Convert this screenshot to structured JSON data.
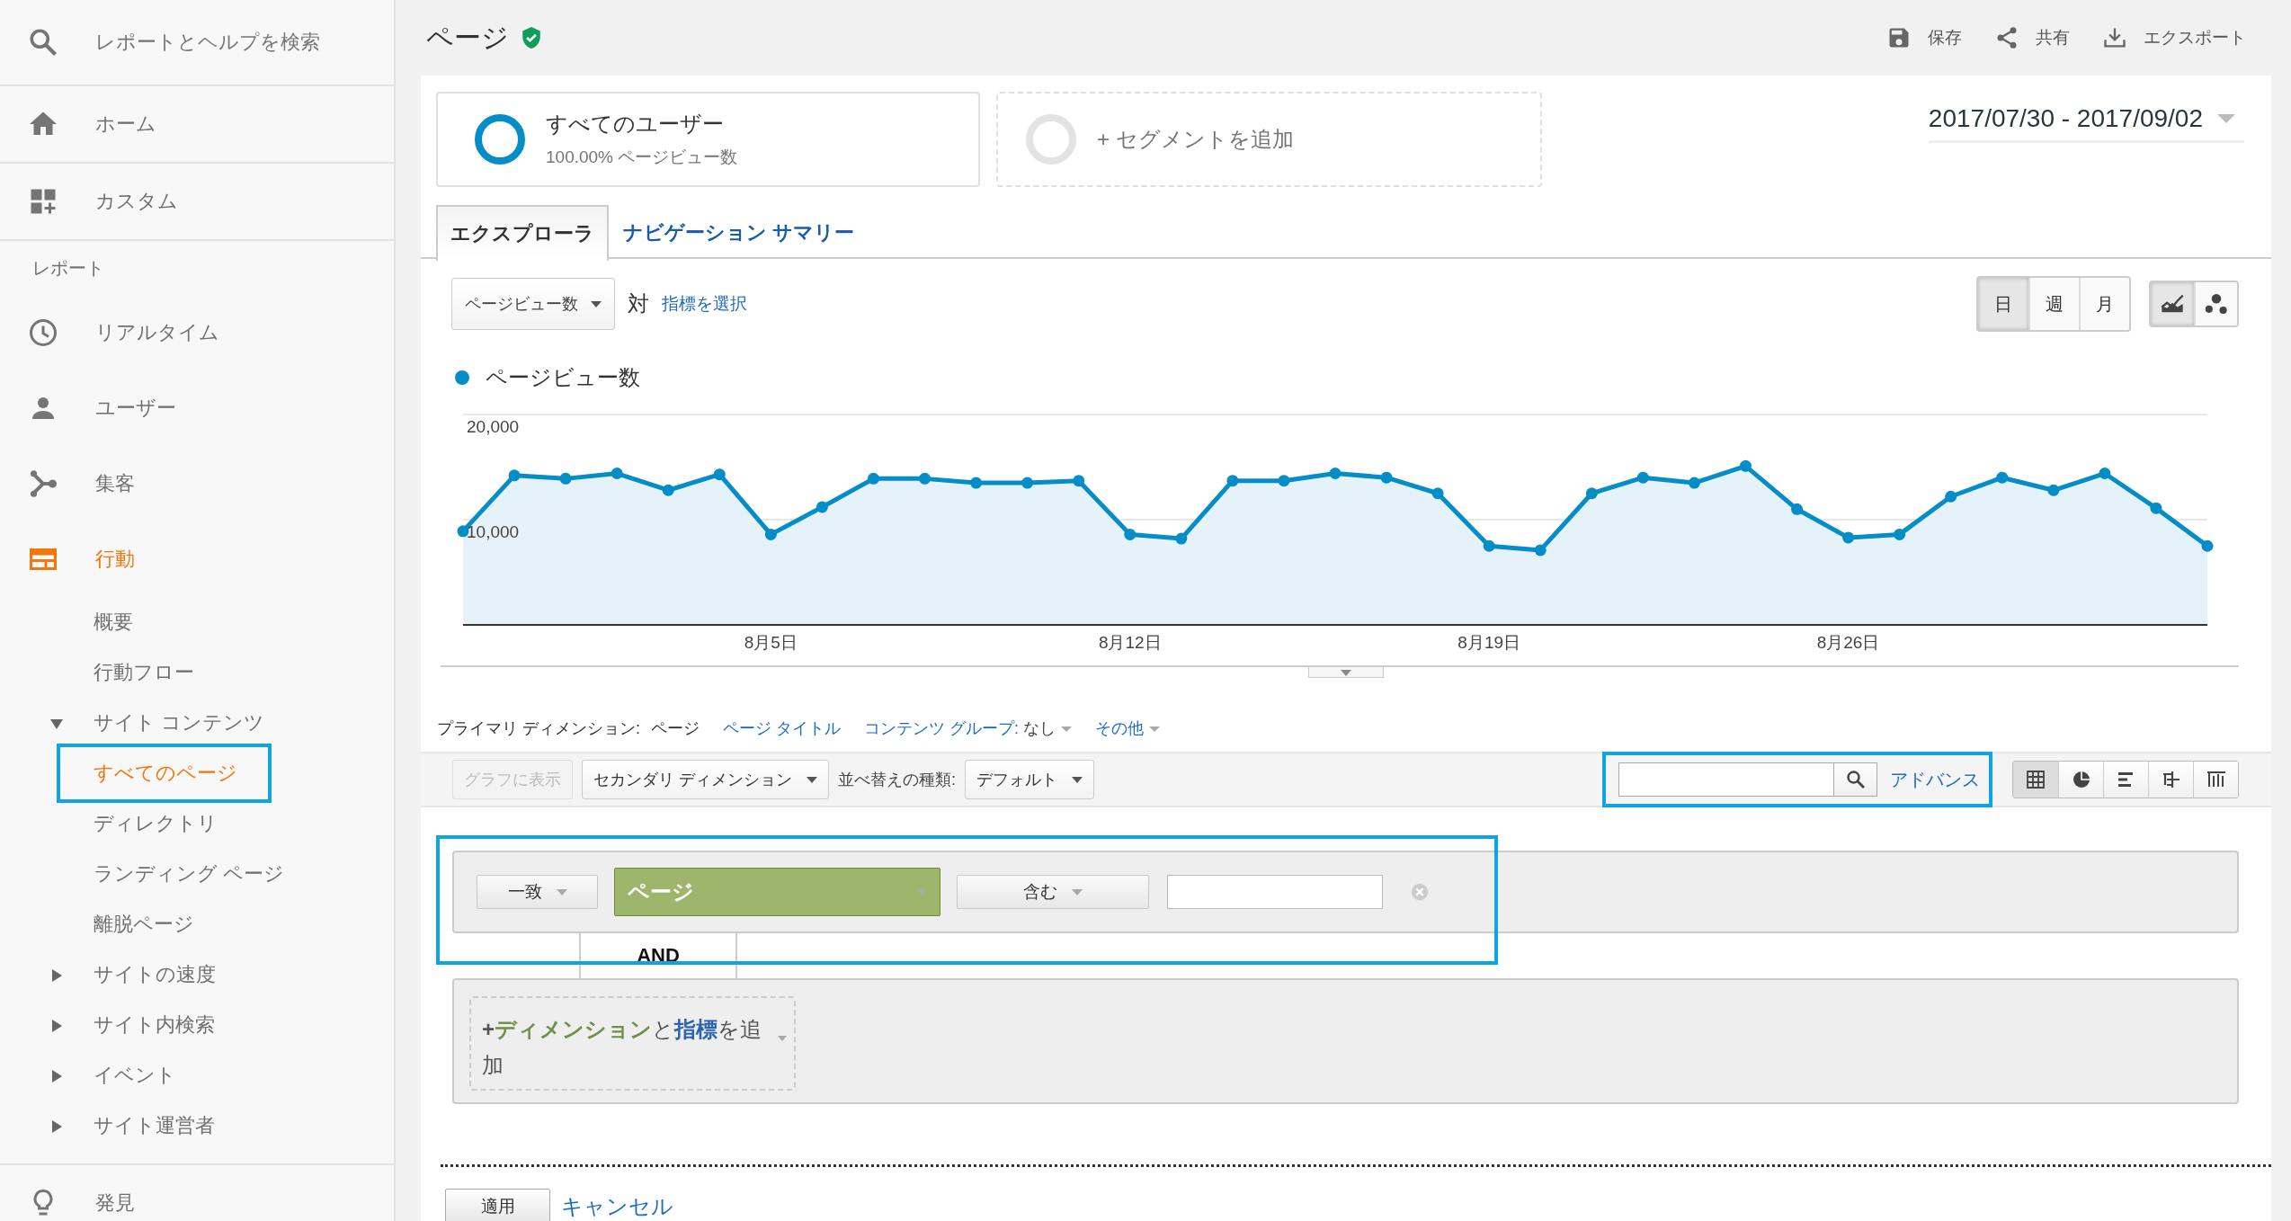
{
  "sidebar": {
    "search": {
      "placeholder": "レポートとヘルプを検索"
    },
    "top_items": [
      {
        "label": "ホーム",
        "selected": false
      },
      {
        "label": "カスタム",
        "selected": false
      }
    ],
    "section_label": "レポート",
    "report_items": [
      {
        "label": "リアルタイム",
        "selected": false
      },
      {
        "label": "ユーザー",
        "selected": false
      },
      {
        "label": "集客",
        "selected": false
      },
      {
        "label": "行動",
        "selected": true,
        "children": [
          {
            "label": "概要",
            "selected": false,
            "highlighted": false
          },
          {
            "label": "行動フロー",
            "selected": false,
            "highlighted": false
          },
          {
            "label": "サイト コンテンツ",
            "selected": false,
            "highlighted": false,
            "expanded": true,
            "children": [
              {
                "label": "すべてのページ",
                "selected": true,
                "highlighted": true
              },
              {
                "label": "ディレクトリ",
                "selected": false,
                "highlighted": false
              },
              {
                "label": "ランディング ページ",
                "selected": false,
                "highlighted": false
              },
              {
                "label": "離脱ページ",
                "selected": false,
                "highlighted": false
              }
            ]
          },
          {
            "label": "サイトの速度",
            "selected": false,
            "highlighted": false,
            "expanded": false
          },
          {
            "label": "サイト内検索",
            "selected": false,
            "highlighted": false,
            "expanded": false
          },
          {
            "label": "イベント",
            "selected": false,
            "highlighted": false,
            "expanded": false
          },
          {
            "label": "サイト運営者",
            "selected": false,
            "highlighted": false,
            "expanded": false
          }
        ]
      }
    ],
    "bottom_items": [
      {
        "label": "発見",
        "selected": false
      }
    ]
  },
  "header": {
    "title": "ページ",
    "actions": [
      "保存",
      "共有",
      "エクスポート"
    ]
  },
  "segments": [
    {
      "kind": "active",
      "title": "すべてのユーザー",
      "subtitle": "100.00% ページビュー数"
    },
    {
      "kind": "add",
      "title": "+ セグメントを追加"
    }
  ],
  "date_range": "2017/07/30 - 2017/09/02",
  "tabs": [
    {
      "label": "エクスプローラ",
      "selected": true
    },
    {
      "label": "ナビゲーション サマリー",
      "selected": false
    }
  ],
  "explorer": {
    "metric_select": "ページビュー数",
    "vs_label": "対",
    "select_metric_link": "指標を選択",
    "granularity": [
      {
        "label": "日",
        "selected": true
      },
      {
        "label": "週",
        "selected": false
      },
      {
        "label": "月",
        "selected": false
      }
    ],
    "chart_types": [
      {
        "selected": true
      },
      {
        "selected": false
      }
    ],
    "chart_data": {
      "type": "area",
      "categories": [
        null,
        null,
        null,
        null,
        null,
        null,
        "8月5日",
        null,
        null,
        null,
        null,
        null,
        null,
        "8月12日",
        null,
        null,
        null,
        null,
        null,
        null,
        "8月19日",
        null,
        null,
        null,
        null,
        null,
        null,
        "8月26日",
        null,
        null,
        null,
        null,
        null,
        null,
        null
      ],
      "yticks": [
        {
          "value": 10000,
          "label": "10,000"
        },
        {
          "value": 20000,
          "label": "20,000"
        }
      ],
      "ylim": [
        0,
        20000
      ],
      "series": [
        {
          "name": "ページビュー数",
          "color": "#058dc7",
          "values": [
            8900,
            14200,
            13900,
            14400,
            12800,
            14300,
            8600,
            11200,
            13900,
            13900,
            13500,
            13500,
            13700,
            8600,
            8200,
            13700,
            13700,
            14400,
            14000,
            12500,
            7500,
            7100,
            12500,
            14000,
            13500,
            15100,
            11000,
            8300,
            8600,
            12200,
            14000,
            12800,
            14400,
            11100,
            7500
          ]
        }
      ]
    }
  },
  "dimensions": {
    "label": "プライマリ ディメンション:",
    "items": [
      {
        "kind": "link",
        "label": "ページ",
        "selected": true
      },
      {
        "kind": "link",
        "label": "ページ タイトル",
        "selected": false
      },
      {
        "kind": "menu",
        "label": "コンテンツ グループ:",
        "value": "なし",
        "selected": false
      },
      {
        "kind": "menu",
        "label": "その他",
        "selected": false
      }
    ]
  },
  "toolbar": {
    "plot_rows": {
      "label": "グラフに表示",
      "disabled": true
    },
    "secondary_dimension": "セカンダリ ディメンション",
    "sort_label": "並べ替えの種類:",
    "sort_select": "デフォルト",
    "search": {
      "highlighted": true
    },
    "advanced_link": "アドバンス",
    "views": [
      {
        "selected": true
      },
      {
        "selected": false
      },
      {
        "selected": false
      },
      {
        "selected": false
      },
      {
        "selected": false
      }
    ]
  },
  "filter": {
    "highlighted": true,
    "match": "一致",
    "dimension": "ページ",
    "operator": "含む",
    "and_label": "AND",
    "add_condition": {
      "plus": "+",
      "dimension": "ディメンション",
      "joiner": "と",
      "metric": "指標",
      "tail": "を追加"
    }
  },
  "actions": {
    "apply": "適用",
    "cancel": "キャンセル"
  }
}
